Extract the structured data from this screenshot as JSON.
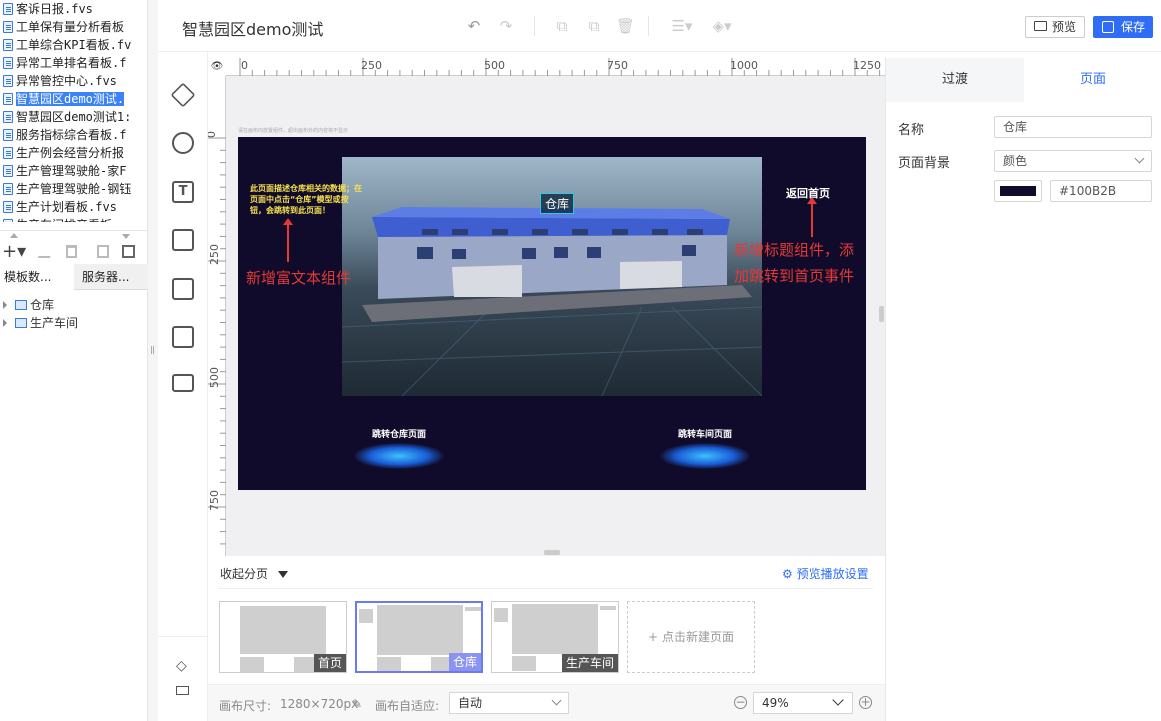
{
  "files": [
    {
      "name": "客诉日报.fvs",
      "selected": false
    },
    {
      "name": "工单保有量分析看板",
      "selected": false
    },
    {
      "name": "工单综合KPI看板.fv",
      "selected": false
    },
    {
      "name": "异常工单排名看板.f",
      "selected": false
    },
    {
      "name": "异常管控中心.fvs",
      "selected": false
    },
    {
      "name": "智慧园区demo测试.",
      "selected": true
    },
    {
      "name": "智慧园区demo测试1:",
      "selected": false
    },
    {
      "name": "服务指标综合看板.f",
      "selected": false
    },
    {
      "name": "生产例会经营分析报",
      "selected": false
    },
    {
      "name": "生产管理驾驶舱-家F",
      "selected": false
    },
    {
      "name": "生产管理驾驶舱-钢钰",
      "selected": false
    },
    {
      "name": "生产计划看板.fvs",
      "selected": false
    },
    {
      "name": "生产车间排产看板",
      "selected": false
    }
  ],
  "left_tabs": [
    "模板数...",
    "服务器..."
  ],
  "tree": [
    "仓库",
    "生产车间"
  ],
  "header": {
    "title": "智慧园区demo测试",
    "preview_label": "预览",
    "save_label": "保存"
  },
  "ruler": {
    "top": [
      "0",
      "250",
      "500",
      "750",
      "1000",
      "1250"
    ],
    "left": [
      "0",
      "250",
      "500",
      "750"
    ]
  },
  "canvas": {
    "hint": "请在画布内放置组件，超出画布外的内容将不显示",
    "richtext": "此页面描述仓库相关的数据；在页面中点击“仓库”模型或按钮，会跳转到此页面！",
    "warehouse_label": "仓库",
    "back_title": "返回首页",
    "btn_warehouse": "跳转仓库页面",
    "btn_workshop": "跳转车间页面",
    "anno_left": "新增富文本组件",
    "anno_right_1": "新增标题组件，添",
    "anno_right_2": "加跳转到首页事件",
    "bg_color": "#100B2B"
  },
  "right_panel": {
    "tabs": [
      "过渡",
      "页面"
    ],
    "name_label": "名称",
    "name_value": "仓库",
    "bg_label": "页面背景",
    "bg_type": "颜色",
    "bg_hex": "#100B2B"
  },
  "pages": {
    "collapse_label": "收起分页",
    "preview_settings": "预览播放设置",
    "items": [
      "首页",
      "仓库",
      "生产车间"
    ],
    "new_page": "点击新建页面"
  },
  "status": {
    "size_label": "画布尺寸:",
    "size_value": "1280×720px",
    "adapt_label": "画布自适应:",
    "adapt_value": "自动",
    "zoom": "49%"
  },
  "colors": {
    "accent": "#2f6df6",
    "annotation": "#e53935"
  }
}
